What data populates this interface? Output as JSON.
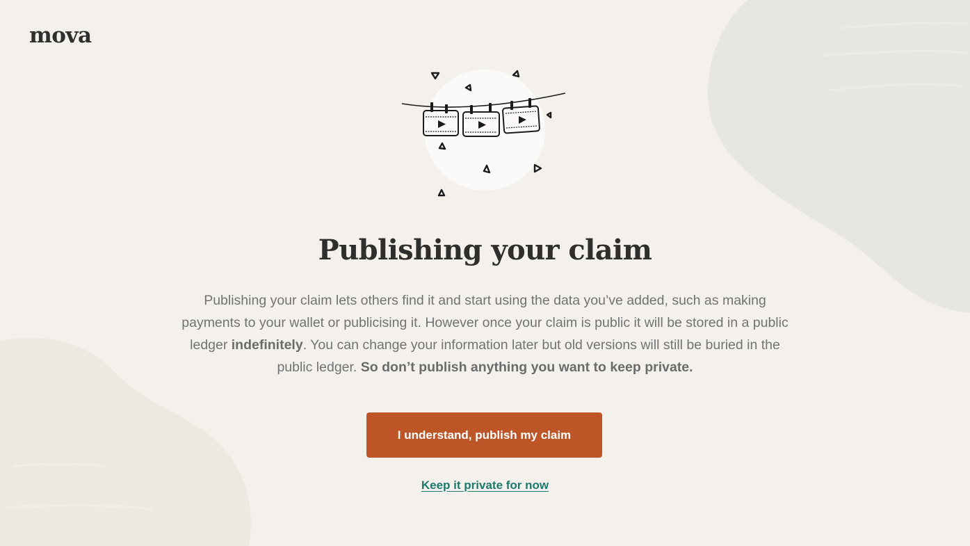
{
  "brand": {
    "logo_text": "mova"
  },
  "hero": {
    "illustration": "video-clips-on-clothesline-illustration"
  },
  "content": {
    "title": "Publishing your claim",
    "paragraph": {
      "part1": "Publishing your claim lets others find it and start using the data you’ve added, such as making payments to your wallet or publicising it. However once your claim is public it will be stored in a public ledger ",
      "bold1": "indefinitely",
      "part2": ". You can change your information later but old versions will still be buried in the public ledger. ",
      "bold2": "So don’t publish anything you want to keep private."
    }
  },
  "actions": {
    "publish_label": "I understand, publish my claim",
    "keep_private_label": "Keep it private for now"
  },
  "colors": {
    "background": "#f4f1ec",
    "blob": "#e9e6e0",
    "primary_button": "#be5526",
    "link": "#1b7a6c",
    "heading": "#2e2e2c",
    "body_text": "#727272"
  }
}
